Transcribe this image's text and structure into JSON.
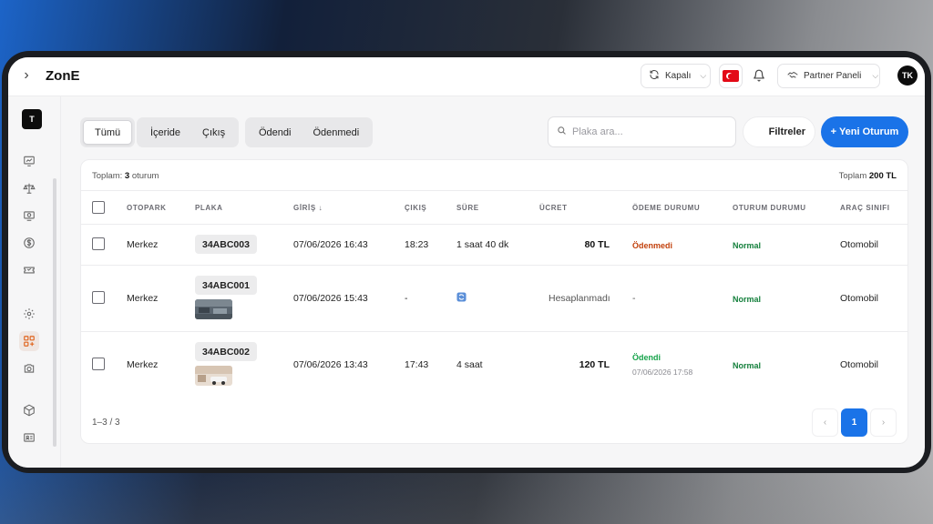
{
  "app": {
    "title": "ZonE"
  },
  "header": {
    "status_label": "Kapalı",
    "panel_label": "Partner Paneli",
    "avatar_initials": "TK"
  },
  "sidebar": {
    "brand_initial": "T",
    "items": [
      {
        "icon": "chart-icon"
      },
      {
        "icon": "scale-icon"
      },
      {
        "icon": "monitor-icon"
      },
      {
        "icon": "dollar-icon"
      },
      {
        "icon": "ticket-icon"
      },
      {
        "icon": "gear-icon"
      },
      {
        "icon": "apps-icon",
        "active": true
      },
      {
        "icon": "camera-icon"
      },
      {
        "icon": "box-icon"
      },
      {
        "icon": "id-card-icon"
      }
    ]
  },
  "filters": {
    "tabs_status": [
      "Tümü",
      "İçeride",
      "Çıkış"
    ],
    "tabs_payment": [
      "Ödendi",
      "Ödenmedi"
    ],
    "active_tab": "Tümü",
    "search_placeholder": "Plaka ara...",
    "filter_button": "Filtreler",
    "new_button": "+ Yeni Oturum"
  },
  "summary": {
    "total_label": "Toplam:",
    "total_count": "3",
    "total_unit": "oturum",
    "sum_label": "Toplam",
    "sum_value": "200 TL"
  },
  "table": {
    "columns": [
      "OTOPARK",
      "PLAKA",
      "GİRİŞ ↓",
      "ÇIKIŞ",
      "SÜRE",
      "ÜCRET",
      "ÖDEME DURUMU",
      "OTURUM DURUMU",
      "ARAÇ SINIFI"
    ],
    "rows": [
      {
        "parking": "Merkez",
        "plate": "34ABC003",
        "entry": "07/06/2026 16:43",
        "exit": "18:23",
        "duration": "1 saat 40 dk",
        "fee": "80 TL",
        "payment": "Ödenmedi",
        "payment_date": "",
        "session": "Normal",
        "vehicle_class": "Otomobil"
      },
      {
        "parking": "Merkez",
        "plate": "34ABC001",
        "entry": "07/06/2026 15:43",
        "exit": "-",
        "duration_icon": "refresh-icon",
        "fee": "Hesaplanmadı",
        "payment": "-",
        "payment_date": "",
        "session": "Normal",
        "vehicle_class": "Otomobil"
      },
      {
        "parking": "Merkez",
        "plate": "34ABC002",
        "entry": "07/06/2026 13:43",
        "exit": "17:43",
        "duration": "4 saat",
        "fee": "120 TL",
        "payment": "Ödendi",
        "payment_date": "07/06/2026 17:58",
        "session": "Normal",
        "vehicle_class": "Otomobil"
      }
    ]
  },
  "pagination": {
    "info": "1–3 / 3",
    "prev": "‹",
    "current": "1",
    "next": "›"
  }
}
